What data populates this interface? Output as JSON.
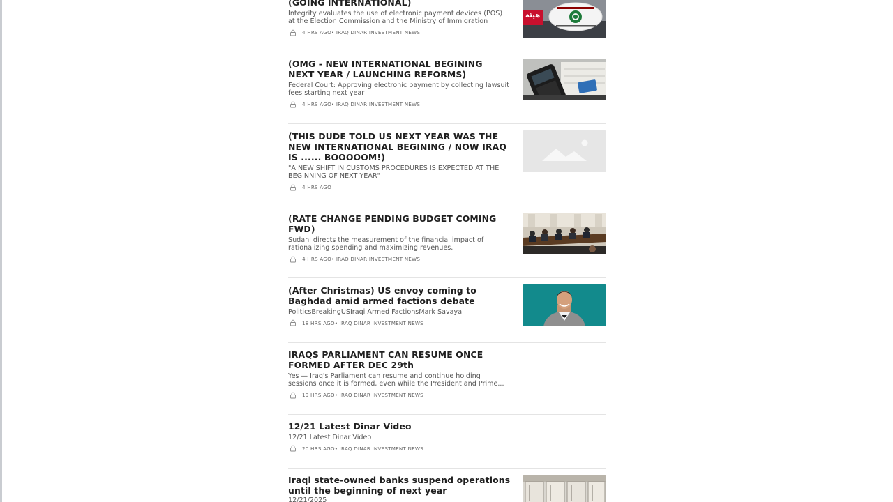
{
  "feed": {
    "items": [
      {
        "title": "(GOING INTERNATIONAL)",
        "subtitle": "Integrity evaluates the use of electronic payment devices (POS) at the Election Commission and the Ministry of Immigration",
        "time": "4 HRS AGO",
        "source": " • IRAQ DINAR INVESTMENT NEWS",
        "thumb_caption": "هيئة"
      },
      {
        "title": "(OMG - NEW INTERNATIONAL BEGINING NEXT YEAR / LAUNCHING REFORMS)",
        "subtitle": "Federal Court: Approving electronic payment by collecting lawsuit fees starting next year",
        "time": "4 HRS AGO",
        "source": " • IRAQ DINAR INVESTMENT NEWS"
      },
      {
        "title": "(THIS DUDE TOLD US NEXT YEAR WAS THE NEW INTERNATIONAL BEGINING / NOW IRAQ IS ...... BOOOOOM!)",
        "subtitle": "\"A NEW SHIFT IN CUSTOMS PROCEDURES IS EXPECTED AT THE BEGINNING OF NEXT YEAR\"",
        "time": "4 HRS AGO",
        "source": ""
      },
      {
        "title": "(RATE CHANGE PENDING BUDGET COMING FWD)",
        "subtitle": "Sudani directs the measurement of the financial impact of rationalizing spending and maximizing revenues.",
        "time": "4 HRS AGO",
        "source": " • IRAQ DINAR INVESTMENT NEWS"
      },
      {
        "title": "(After Christmas) US envoy coming to Baghdad amid armed factions debate",
        "subtitle": "PoliticsBreakingUSIraqi Armed FactionsMark Savaya",
        "time": "18 HRS AGO",
        "source": " • IRAQ DINAR INVESTMENT NEWS"
      },
      {
        "title": "IRAQS PARLIAMENT CAN RESUME ONCE FORMED AFTER DEC 29th",
        "subtitle": "Yes — Iraq's Parliament can resume and continue holding sessions once it is formed, even while the President and Prime...",
        "time": "19 HRS AGO",
        "source": " • IRAQ DINAR INVESTMENT NEWS"
      },
      {
        "title": "12/21 Latest Dinar Video",
        "subtitle": "12/21 Latest Dinar Video",
        "time": "20 HRS AGO",
        "source": " • IRAQ DINAR INVESTMENT NEWS"
      },
      {
        "title": "Iraqi state-owned banks suspend operations until the beginning of next year",
        "subtitle": "12/21/2025",
        "time": "",
        "source": ""
      }
    ]
  },
  "colors": {
    "title": "#1f1f1f",
    "subtitle": "#555555",
    "meta": "#666666",
    "divider": "#e4e4e4"
  },
  "icons": {
    "lock": "lock-icon",
    "placeholder": "image-placeholder-icon"
  }
}
